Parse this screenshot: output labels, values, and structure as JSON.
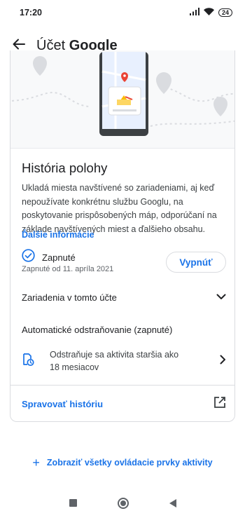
{
  "status_bar": {
    "time": "17:20",
    "battery": "24",
    "icons": [
      "signal-icon",
      "wifi-icon",
      "battery-icon"
    ]
  },
  "app_bar": {
    "title_prefix": "Účet",
    "title_brand": "Google",
    "back_icon": "arrow-back-icon"
  },
  "card": {
    "title": "História polohy",
    "description": "Ukladá miesta navštívené so zariadeniami, aj keď nepoužívate konkrétnu službu Googlu, na poskytovanie prispôsobených máp, odporúčaní na základe navštívených miest a ďalšieho obsahu.",
    "learn_more": "Ďalšie informácie",
    "status_label": "Zapnuté",
    "status_date": "Zapnuté od 11. apríla 2021",
    "turn_off_button": "Vypnúť",
    "devices_label": "Zariadenia v tomto účte",
    "auto_delete_title": "Automatické odstraňovanie (zapnuté)",
    "auto_delete_line1": "Odstraňuje sa aktivita staršia ako",
    "auto_delete_line2": "18 mesiacov",
    "manage_history": "Spravovať históriu"
  },
  "footer": {
    "show_all": "Zobraziť všetky ovládacie prvky aktivity"
  },
  "colors": {
    "accent": "#1a73e8",
    "text_primary": "#202124",
    "text_secondary": "#5f6368",
    "divider": "#dadce0"
  }
}
